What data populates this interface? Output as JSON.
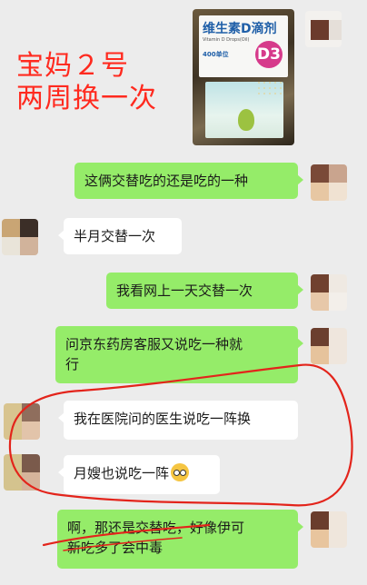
{
  "overlay": {
    "line1": "宝妈２号",
    "line2": "两周换一次"
  },
  "product_photo": {
    "box_title": "维生素D滴剂",
    "box_subtitle": "Vitamin D Drops(Oil)",
    "box_dose": "400单位",
    "box_badge": "D3"
  },
  "messages": [
    {
      "side": "me",
      "text": "这俩交替吃的还是吃的一种"
    },
    {
      "side": "other",
      "text": "半月交替一次"
    },
    {
      "side": "me",
      "text": "我看网上一天交替一次"
    },
    {
      "side": "me",
      "text_line1": "问京东药房客服又说吃一种就",
      "text_line2": "行"
    },
    {
      "side": "other",
      "text": "我在医院问的医生说吃一阵换"
    },
    {
      "side": "other",
      "text": "月嫂也说吃一阵",
      "emoji": "flushed-face"
    },
    {
      "side": "me",
      "text_line1": "啊，那还是交替吃，好像伊可",
      "text_line2": "新吃多了会中毒"
    }
  ],
  "colors": {
    "background": "#ececec",
    "my_bubble": "#95ec69",
    "other_bubble": "#ffffff",
    "annotation_red": "#e3241b"
  }
}
